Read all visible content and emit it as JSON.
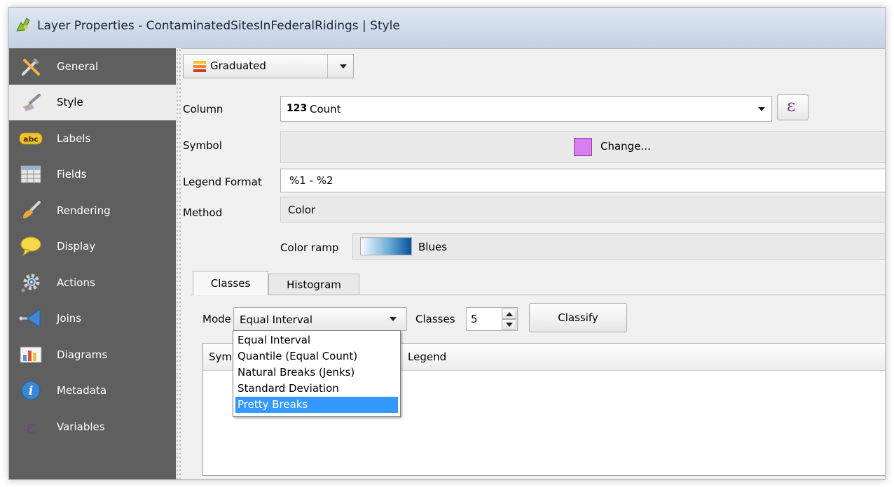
{
  "window": {
    "title": "Layer Properties - ContaminatedSitesInFederalRidings | Style"
  },
  "sidebar": {
    "items": [
      {
        "label": "General",
        "icon": "general-tools-icon",
        "active": false
      },
      {
        "label": "Style",
        "icon": "style-brush-icon",
        "active": true
      },
      {
        "label": "Labels",
        "icon": "labels-abc-icon",
        "active": false
      },
      {
        "label": "Fields",
        "icon": "fields-table-icon",
        "active": false
      },
      {
        "label": "Rendering",
        "icon": "rendering-brush-icon",
        "active": false
      },
      {
        "label": "Display",
        "icon": "display-speech-bubble-icon",
        "active": false
      },
      {
        "label": "Actions",
        "icon": "actions-gear-icon",
        "active": false
      },
      {
        "label": "Joins",
        "icon": "joins-arrow-icon",
        "active": false
      },
      {
        "label": "Diagrams",
        "icon": "diagrams-chart-icon",
        "active": false
      },
      {
        "label": "Metadata",
        "icon": "metadata-info-icon",
        "active": false
      },
      {
        "label": "Variables",
        "icon": "variables-epsilon-icon",
        "active": false
      }
    ]
  },
  "renderer": {
    "value": "Graduated"
  },
  "column": {
    "label": "Column",
    "type_badge": "123",
    "value": "Count",
    "expression_icon": "ε"
  },
  "symbol": {
    "label": "Symbol",
    "button": "Change...",
    "swatch_color": "#d87ef0"
  },
  "legend_format": {
    "label": "Legend Format",
    "value": "%1 - %2"
  },
  "method": {
    "label": "Method",
    "value": "Color"
  },
  "color_ramp": {
    "label": "Color ramp",
    "value": "Blues"
  },
  "tabs": [
    {
      "label": "Classes",
      "active": true
    },
    {
      "label": "Histogram",
      "active": false
    }
  ],
  "classes_panel": {
    "mode_label": "Mode",
    "mode_value": "Equal Interval",
    "classes_label": "Classes",
    "classes_value": "5",
    "classify_button": "Classify",
    "table_headers": [
      "Symb",
      "Legend"
    ]
  },
  "mode_dropdown": {
    "options": [
      "Equal Interval",
      "Quantile (Equal Count)",
      "Natural Breaks (Jenks)",
      "Standard Deviation",
      "Pretty Breaks"
    ],
    "highlighted": "Pretty Breaks"
  }
}
